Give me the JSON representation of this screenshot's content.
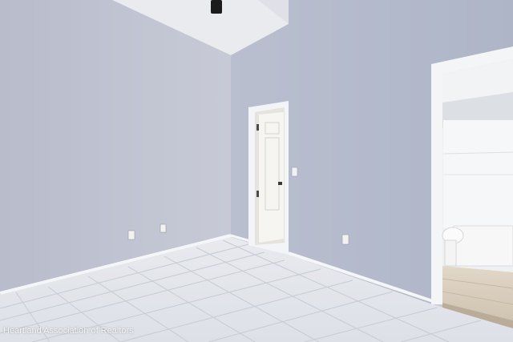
{
  "photo": {
    "watermark_text": "Heartland Association of Realtors",
    "subject": "empty-room-interior",
    "colors": {
      "wall_left": "#bcc0ce",
      "wall_right": "#b4bbcb",
      "ceiling": "#e9eaee",
      "floor_tile": "#e3e6ec",
      "grout": "#c6cad3",
      "trim": "#f4f5f7",
      "bath_floor": "#d8cdbd"
    }
  }
}
